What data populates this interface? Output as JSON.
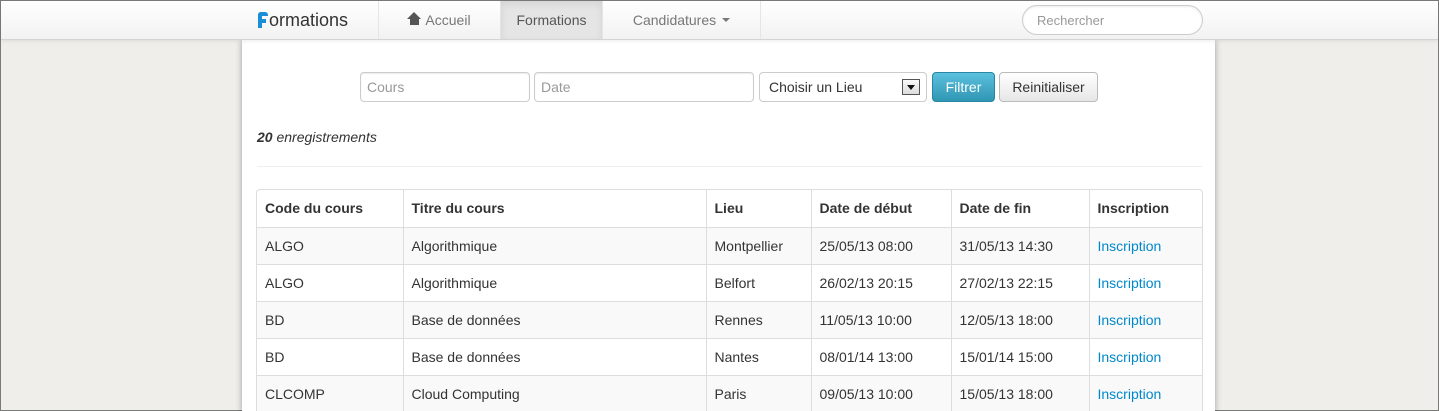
{
  "navbar": {
    "brand_rest": "ormations",
    "items": [
      {
        "label": "Accueil"
      },
      {
        "label": "Formations"
      },
      {
        "label": "Candidatures"
      }
    ],
    "search_placeholder": "Rechercher"
  },
  "filters": {
    "cours_placeholder": "Cours",
    "date_placeholder": "Date",
    "lieu_selected": "Choisir un Lieu",
    "filter_button": "Filtrer",
    "reset_button": "Reinitialiser"
  },
  "records": {
    "count": "20",
    "label": "enregistrements"
  },
  "table": {
    "headers": [
      "Code du cours",
      "Titre du cours",
      "Lieu",
      "Date de début",
      "Date de fin",
      "Inscription"
    ],
    "rows": [
      {
        "code": "ALGO",
        "titre": "Algorithmique",
        "lieu": "Montpellier",
        "debut": "25/05/13 08:00",
        "fin": "31/05/13 14:30",
        "inscription": "Inscription"
      },
      {
        "code": "ALGO",
        "titre": "Algorithmique",
        "lieu": "Belfort",
        "debut": "26/02/13 20:15",
        "fin": "27/02/13 22:15",
        "inscription": "Inscription"
      },
      {
        "code": "BD",
        "titre": "Base de données",
        "lieu": "Rennes",
        "debut": "11/05/13 10:00",
        "fin": "12/05/13 18:00",
        "inscription": "Inscription"
      },
      {
        "code": "BD",
        "titre": "Base de données",
        "lieu": "Nantes",
        "debut": "08/01/14 13:00",
        "fin": "15/01/14 15:00",
        "inscription": "Inscription"
      },
      {
        "code": "CLCOMP",
        "titre": "Cloud Computing",
        "lieu": "Paris",
        "debut": "09/05/13 10:00",
        "fin": "15/05/13 18:00",
        "inscription": "Inscription"
      }
    ]
  },
  "colors": {
    "brand": "#1a8fd8",
    "link": "#0088cc",
    "filter_button": "#49afcd"
  }
}
